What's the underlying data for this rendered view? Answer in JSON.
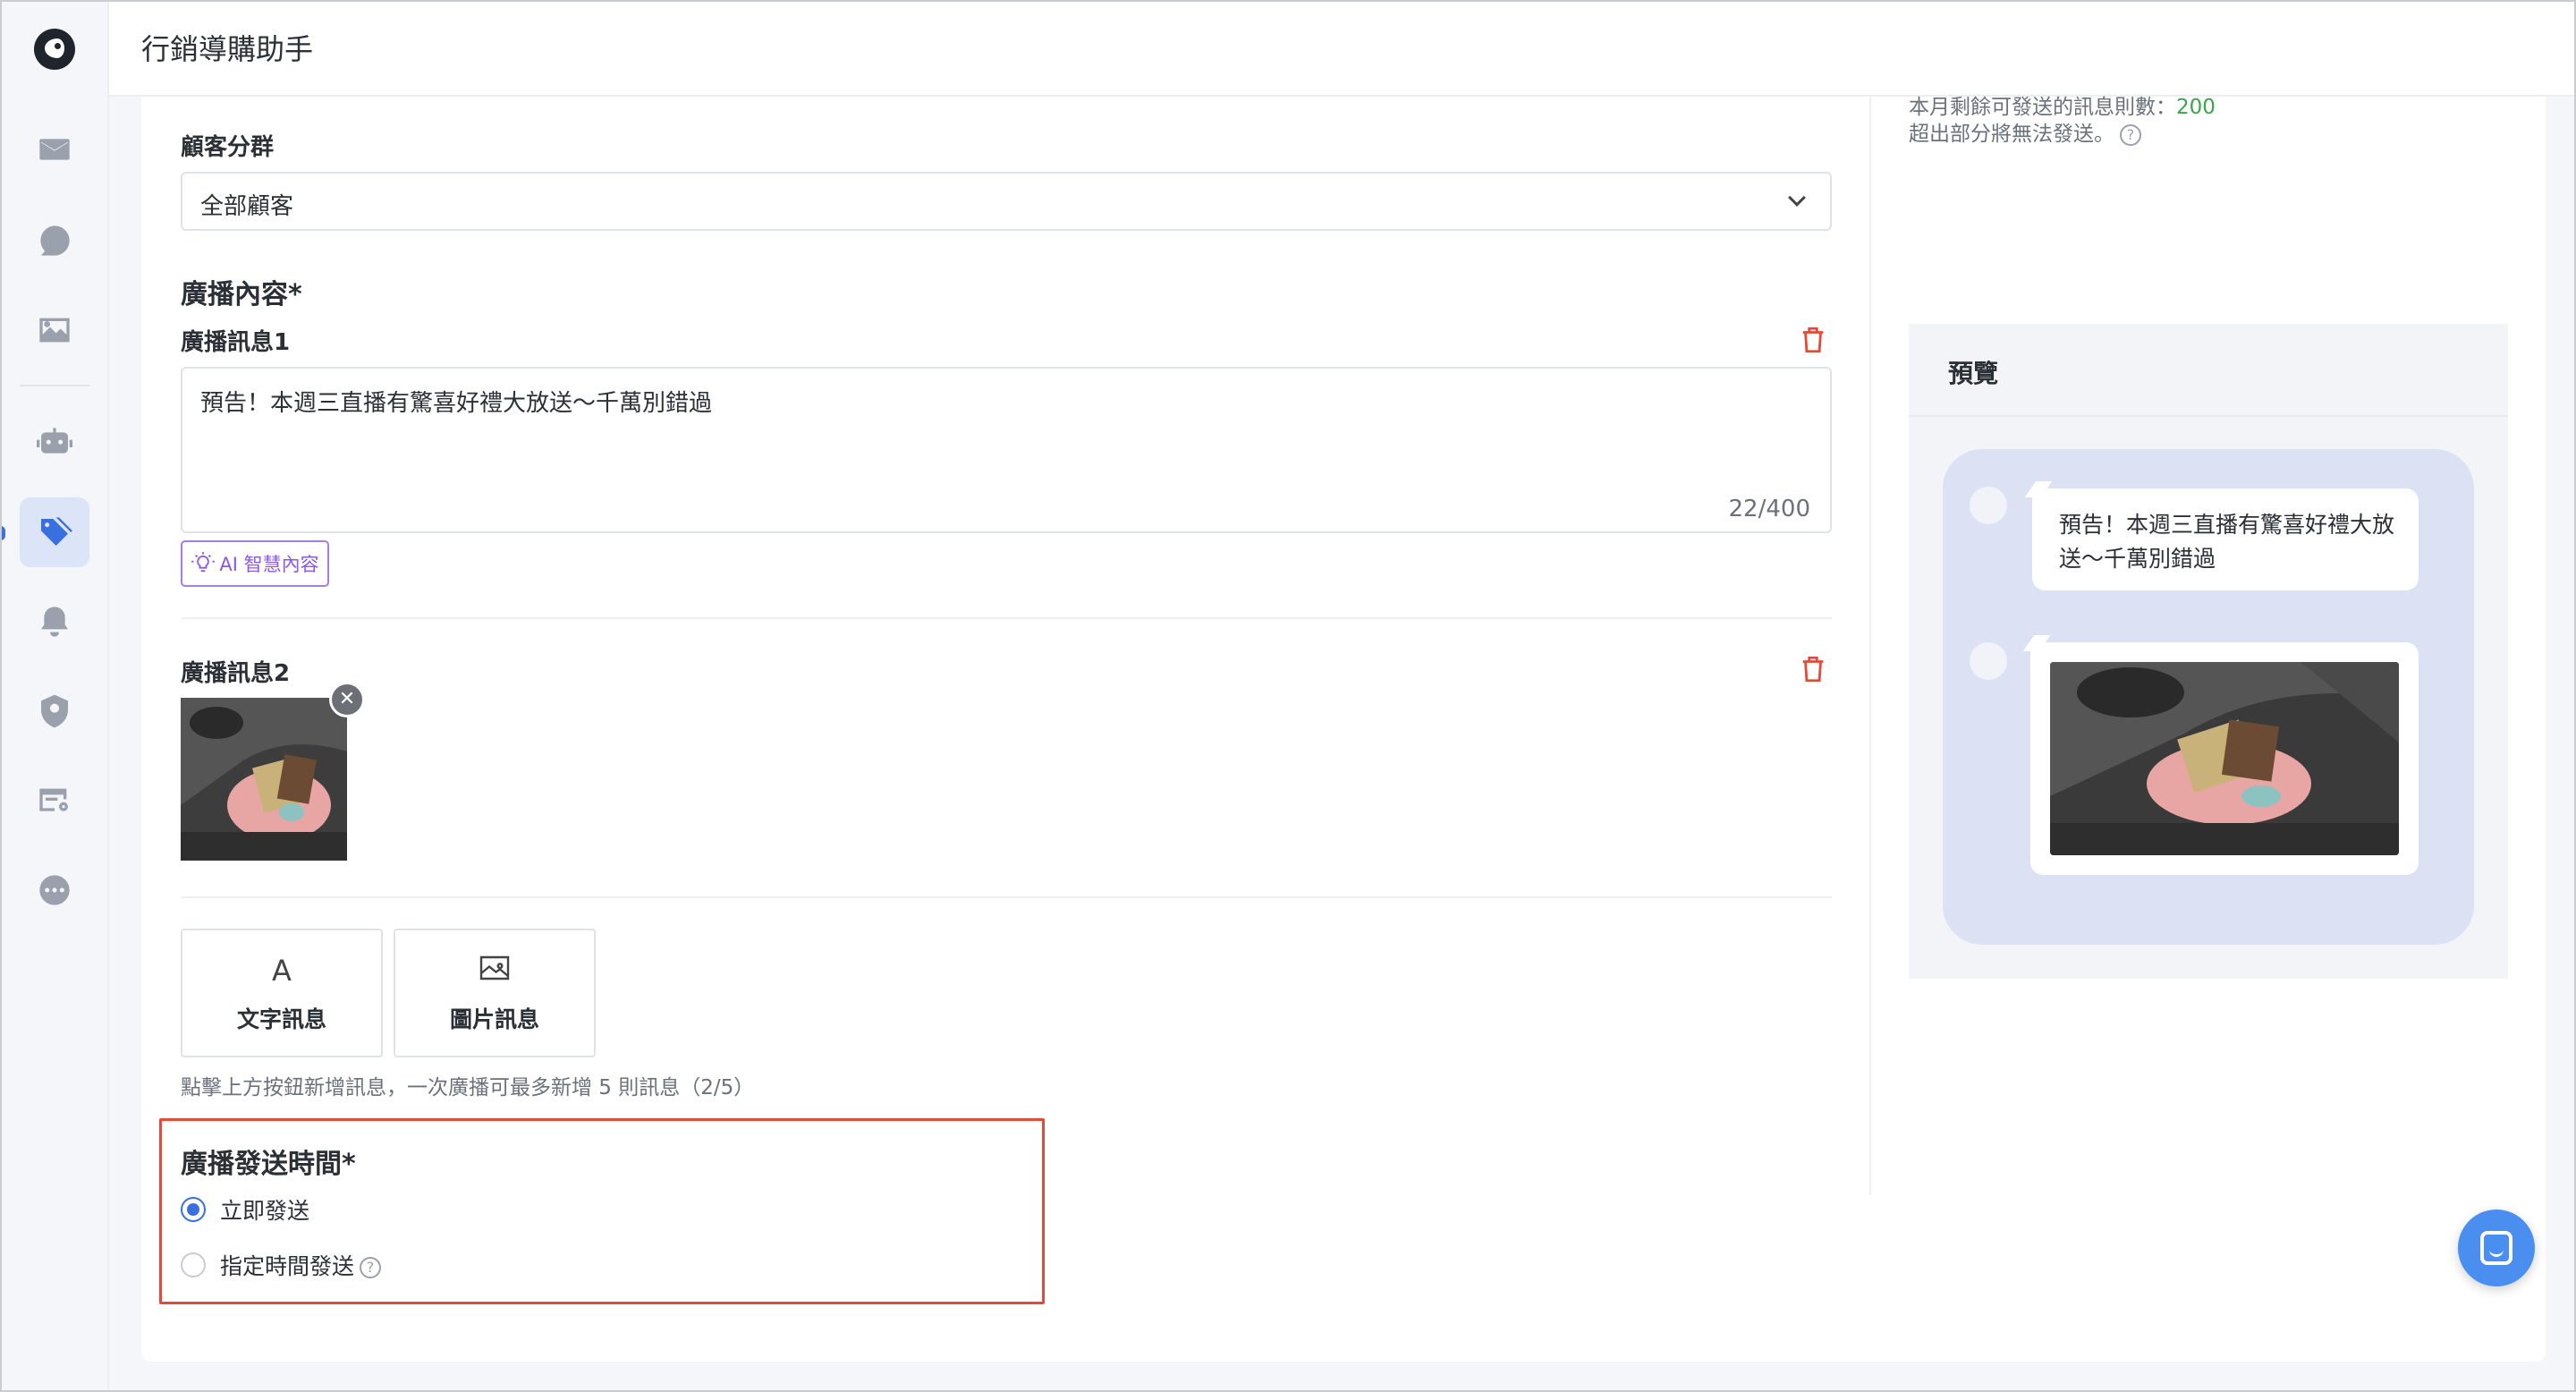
{
  "app": {
    "title": "行銷導購助手"
  },
  "sidebar": {
    "items": [
      {
        "name": "mail",
        "icon": "mail-icon"
      },
      {
        "name": "chat",
        "icon": "chat-bubble-icon"
      },
      {
        "name": "gallery",
        "icon": "image-icon"
      },
      {
        "name": "bot",
        "icon": "robot-icon"
      },
      {
        "name": "marketing",
        "icon": "tag-icon",
        "active": true
      },
      {
        "name": "notifications",
        "icon": "bell-icon"
      },
      {
        "name": "contacts",
        "icon": "user-shield-icon"
      },
      {
        "name": "campaign-settings",
        "icon": "card-gear-icon"
      },
      {
        "name": "more",
        "icon": "more-dots-icon"
      }
    ]
  },
  "quota": {
    "line1_prefix": "本月剩餘可發送的訊息則數：",
    "line1_value": "200",
    "line2": "超出部分將無法發送。"
  },
  "segment": {
    "label": "顧客分群",
    "selected": "全部顧客"
  },
  "content": {
    "section_title": "廣播內容*",
    "message1": {
      "label": "廣播訊息1",
      "text": "預告！本週三直播有驚喜好禮大放送～千萬別錯過",
      "char_count": "22/400",
      "ai_button": "AI 智慧內容"
    },
    "message2": {
      "label": "廣播訊息2"
    },
    "add_buttons": [
      {
        "label": "文字訊息",
        "icon": "A"
      },
      {
        "label": "圖片訊息",
        "icon": "image-icon"
      }
    ],
    "hint": "點擊上方按鈕新增訊息，一次廣播可最多新增 5 則訊息（2/5）"
  },
  "schedule": {
    "title": "廣播發送時間*",
    "options": [
      {
        "label": "立即發送",
        "checked": true
      },
      {
        "label": "指定時間發送",
        "checked": false
      }
    ]
  },
  "preview": {
    "title": "預覽",
    "bubble_text": "預告！本週三直播有驚喜好禮大放送～千萬別錯過"
  },
  "colors": {
    "accent": "#3a6fe0",
    "danger": "#e24b3b",
    "ai_purple": "#8b58e8",
    "quota_green": "#3aa54b",
    "chat_bg": "#dde1f4"
  }
}
